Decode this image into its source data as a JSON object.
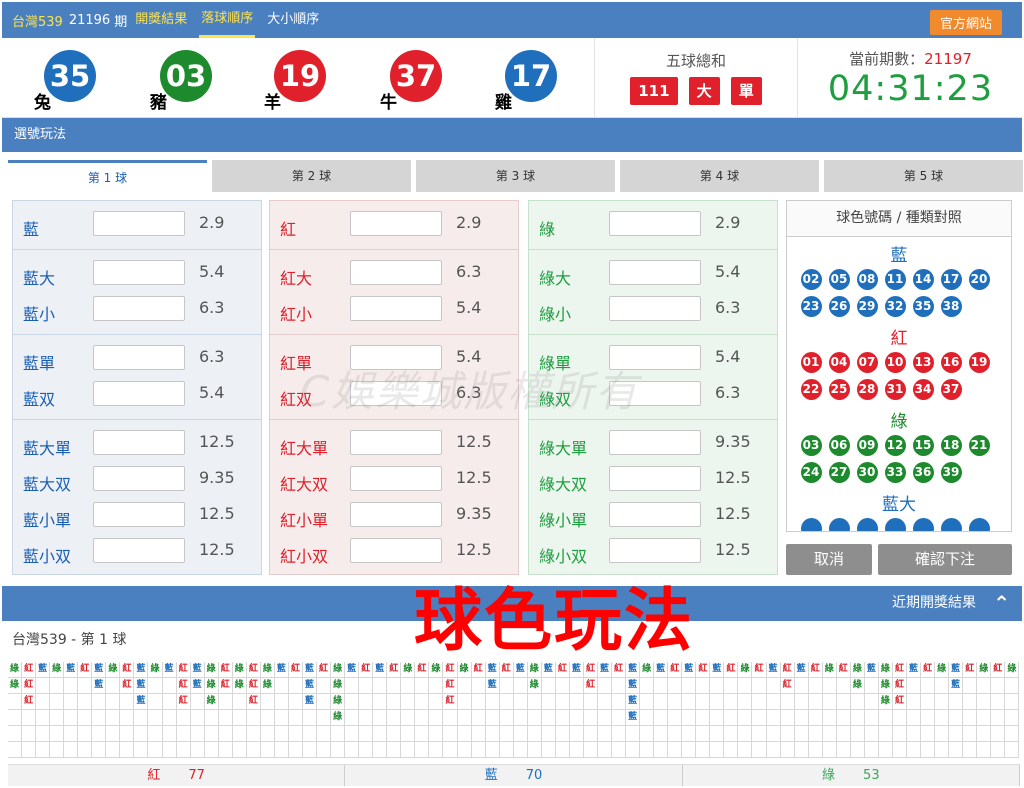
{
  "header": {
    "lottery": "台灣539",
    "issue_number": "21196",
    "issue_suffix": "期",
    "tabs": [
      {
        "label": "開獎結果"
      },
      {
        "label": "落球順序",
        "active": true
      },
      {
        "label": "大小順序"
      }
    ],
    "official_button": "官方網站"
  },
  "draw": {
    "balls": [
      {
        "num": "35",
        "zodiac": "兔",
        "color": "#1f6fbd"
      },
      {
        "num": "03",
        "zodiac": "豬",
        "color": "#1e8a2e"
      },
      {
        "num": "19",
        "zodiac": "羊",
        "color": "#e0202a"
      },
      {
        "num": "37",
        "zodiac": "牛",
        "color": "#e0202a"
      },
      {
        "num": "17",
        "zodiac": "雞",
        "color": "#1f6fbd"
      }
    ],
    "sum_label": "五球總和",
    "sum_value": "111",
    "sum_size": "大",
    "sum_parity": "單",
    "period_label": "當前期數：",
    "period_value": "21197",
    "countdown": "04:31:23"
  },
  "play": {
    "section_title": "選號玩法",
    "ball_tabs": [
      "第 1 球",
      "第 2 球",
      "第 3 球",
      "第 4 球",
      "第 5 球"
    ],
    "active_tab": 0,
    "blue": {
      "rows": [
        {
          "label": "藍",
          "odds": "2.9"
        },
        {
          "label": "藍大",
          "odds": "5.4"
        },
        {
          "label": "藍小",
          "odds": "6.3"
        },
        {
          "label": "藍單",
          "odds": "6.3"
        },
        {
          "label": "藍双",
          "odds": "5.4"
        },
        {
          "label": "藍大單",
          "odds": "12.5"
        },
        {
          "label": "藍大双",
          "odds": "9.35"
        },
        {
          "label": "藍小單",
          "odds": "12.5"
        },
        {
          "label": "藍小双",
          "odds": "12.5"
        }
      ]
    },
    "red": {
      "rows": [
        {
          "label": "紅",
          "odds": "2.9"
        },
        {
          "label": "紅大",
          "odds": "6.3"
        },
        {
          "label": "紅小",
          "odds": "5.4"
        },
        {
          "label": "紅單",
          "odds": "5.4"
        },
        {
          "label": "紅双",
          "odds": "6.3"
        },
        {
          "label": "紅大單",
          "odds": "12.5"
        },
        {
          "label": "紅大双",
          "odds": "12.5"
        },
        {
          "label": "紅小單",
          "odds": "9.35"
        },
        {
          "label": "紅小双",
          "odds": "12.5"
        }
      ]
    },
    "green": {
      "rows": [
        {
          "label": "綠",
          "odds": "2.9"
        },
        {
          "label": "綠大",
          "odds": "5.4"
        },
        {
          "label": "綠小",
          "odds": "6.3"
        },
        {
          "label": "綠單",
          "odds": "5.4"
        },
        {
          "label": "綠双",
          "odds": "6.3"
        },
        {
          "label": "綠大單",
          "odds": "9.35"
        },
        {
          "label": "綠大双",
          "odds": "12.5"
        },
        {
          "label": "綠小單",
          "odds": "12.5"
        },
        {
          "label": "綠小双",
          "odds": "12.5"
        }
      ]
    },
    "cancel": "取消",
    "confirm": "確認下注"
  },
  "reference": {
    "title": "球色號碼 / 種類對照",
    "groups": [
      {
        "name": "藍",
        "color": "#1f6fbd",
        "numbers": [
          "02",
          "05",
          "08",
          "11",
          "14",
          "17",
          "20",
          "23",
          "26",
          "29",
          "32",
          "35",
          "38"
        ]
      },
      {
        "name": "紅",
        "color": "#e0202a",
        "numbers": [
          "01",
          "04",
          "07",
          "10",
          "13",
          "16",
          "19",
          "22",
          "25",
          "28",
          "31",
          "34",
          "37"
        ]
      },
      {
        "name": "綠",
        "color": "#1e8a2e",
        "numbers": [
          "03",
          "06",
          "09",
          "12",
          "15",
          "18",
          "21",
          "24",
          "27",
          "30",
          "33",
          "36",
          "39"
        ]
      },
      {
        "name": "藍大",
        "color": "#1f6fbd",
        "numbers": []
      }
    ]
  },
  "recent": {
    "bar_title": "近期開獎結果",
    "big_title": "球色玩法",
    "history_title": "台灣539 - 第 1 球",
    "watermark": "C娛樂城版權所有",
    "road": [
      [
        "綠",
        "綠"
      ],
      [
        "紅",
        "紅",
        "紅"
      ],
      [
        "藍"
      ],
      [
        "綠"
      ],
      [
        "藍"
      ],
      [
        "紅"
      ],
      [
        "藍",
        "藍"
      ],
      [
        "綠"
      ],
      [
        "紅",
        "紅"
      ],
      [
        "藍",
        "藍",
        "藍"
      ],
      [
        "綠"
      ],
      [
        "藍"
      ],
      [
        "紅",
        "紅",
        "紅"
      ],
      [
        "藍",
        "藍"
      ],
      [
        "綠",
        "綠",
        "綠"
      ],
      [
        "紅",
        "紅"
      ],
      [
        "綠",
        "綠"
      ],
      [
        "紅",
        "紅",
        "紅"
      ],
      [
        "綠",
        "綠"
      ],
      [
        "藍"
      ],
      [
        "紅"
      ],
      [
        "藍",
        "藍",
        "藍"
      ],
      [
        "紅"
      ],
      [
        "綠",
        "綠",
        "綠",
        "綠"
      ],
      [
        "藍"
      ],
      [
        "紅"
      ],
      [
        "藍"
      ],
      [
        "紅"
      ],
      [
        "綠"
      ],
      [
        "紅"
      ],
      [
        "綠"
      ],
      [
        "紅",
        "紅",
        "紅"
      ],
      [
        "綠"
      ],
      [
        "紅"
      ],
      [
        "藍",
        "藍"
      ],
      [
        "紅"
      ],
      [
        "藍"
      ],
      [
        "綠",
        "綠"
      ],
      [
        "藍"
      ],
      [
        "紅"
      ],
      [
        "藍"
      ],
      [
        "紅",
        "紅"
      ],
      [
        "藍"
      ],
      [
        "紅"
      ],
      [
        "藍",
        "藍",
        "藍",
        "藍"
      ],
      [
        "綠"
      ],
      [
        "藍"
      ],
      [
        "紅"
      ],
      [
        "藍"
      ],
      [
        "紅"
      ],
      [
        "藍"
      ],
      [
        "紅"
      ],
      [
        "綠"
      ],
      [
        "紅"
      ],
      [
        "藍"
      ],
      [
        "紅",
        "紅"
      ],
      [
        "藍"
      ],
      [
        "紅"
      ],
      [
        "綠"
      ],
      [
        "紅"
      ],
      [
        "綠",
        "綠"
      ],
      [
        "藍"
      ],
      [
        "綠",
        "綠",
        "綠"
      ],
      [
        "紅",
        "紅",
        "紅"
      ],
      [
        "藍"
      ],
      [
        "紅"
      ],
      [
        "綠"
      ],
      [
        "藍",
        "藍"
      ],
      [
        "紅"
      ],
      [
        "綠"
      ],
      [
        "紅"
      ],
      [
        "綠"
      ]
    ],
    "road_colors": {
      "藍": "#1f6fbd",
      "紅": "#e0202a",
      "綠": "#1e8a2e"
    },
    "totals": [
      {
        "label": "紅",
        "count": "77",
        "color": "#e0202a"
      },
      {
        "label": "藍",
        "count": "70",
        "color": "#1f6fbd"
      },
      {
        "label": "綠",
        "count": "53",
        "color": "#3aa85a"
      }
    ]
  }
}
